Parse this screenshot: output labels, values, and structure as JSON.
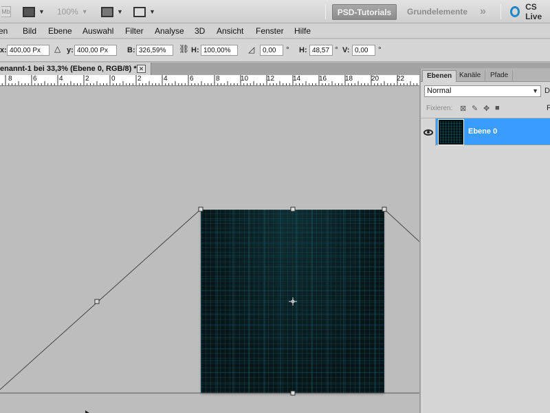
{
  "appbar": {
    "mb_label": "Mb",
    "zoom": "100%",
    "workspace_active": "PSD-Tutorials",
    "workspace_other": "Grundelemente",
    "more": "»",
    "cs_live": "CS Live"
  },
  "menu": {
    "items": [
      "...en",
      "Bild",
      "Ebene",
      "Auswahl",
      "Filter",
      "Analyse",
      "3D",
      "Ansicht",
      "Fenster",
      "Hilfe"
    ],
    "first_visible": "en"
  },
  "options": {
    "x_label": "x:",
    "x_value": "400,00 Px",
    "y_label": "y:",
    "y_value": "400,00 Px",
    "w_label": "B:",
    "w_value": "326,59%",
    "h_label": "H:",
    "h_value": "100,00%",
    "rot_value": "0,00",
    "deg1": "°",
    "hskew_label": "H:",
    "hskew_value": "48,57",
    "deg2": "°",
    "vskew_label": "V:",
    "vskew_value": "0,00",
    "deg3": "°"
  },
  "document": {
    "tab_title": "enannt-1 bei 33,3% (Ebene 0, RGB/8) *",
    "close": "✕"
  },
  "ruler": {
    "ticks": [
      "8",
      "6",
      "4",
      "2",
      "0",
      "2",
      "4",
      "6",
      "8",
      "10",
      "12",
      "14",
      "16",
      "18",
      "20",
      "22"
    ]
  },
  "panel": {
    "tabs": [
      "Ebenen",
      "Kanäle",
      "Pfade"
    ],
    "blend_mode": "Normal",
    "opacity_label": "Deck",
    "lock_label": "Fixieren:",
    "fill_label": "F",
    "layer_name": "Ebene 0"
  },
  "colors": {
    "selection": "#3b9cff",
    "workspace_button": "#999999",
    "cs_live_ring": "#1e88c8"
  }
}
